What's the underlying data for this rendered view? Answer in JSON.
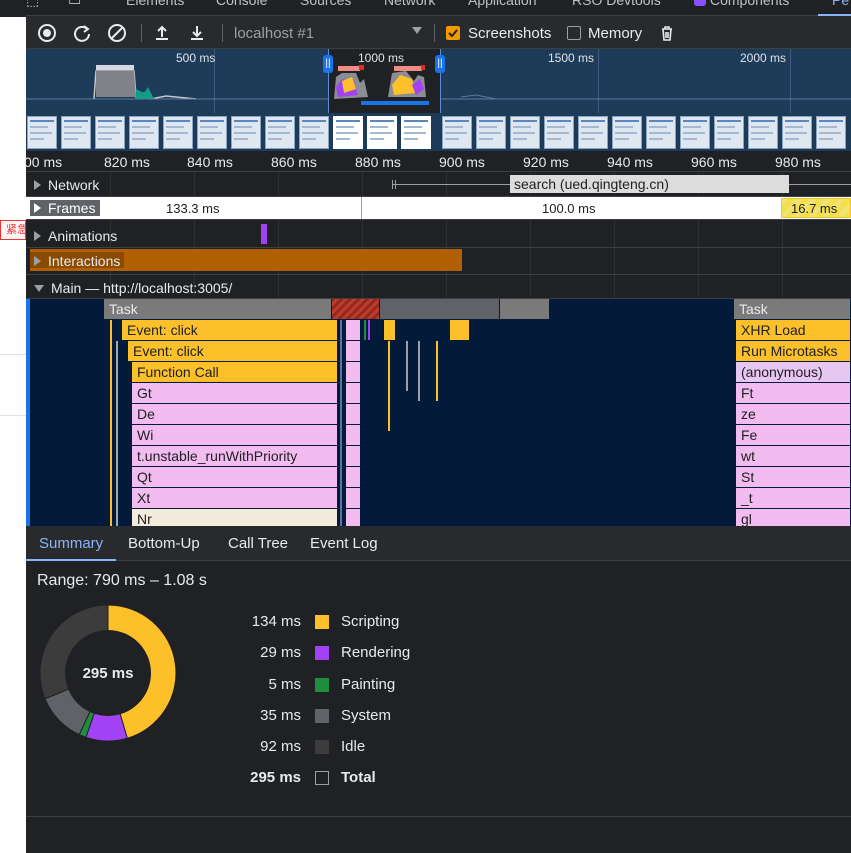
{
  "tabs": {
    "elements": "Elements",
    "console": "Console",
    "sources": "Sources",
    "network": "Network",
    "application": "Application",
    "rso": "RSO Devtools",
    "components": "Components",
    "performance_partial": "Pe"
  },
  "toolbar": {
    "profile_select": "localhost #1",
    "screenshots_label": "Screenshots",
    "screenshots_checked": true,
    "memory_label": "Memory",
    "memory_checked": false
  },
  "overview": {
    "ticks": [
      "500 ms",
      "1000 ms",
      "1500 ms",
      "2000 ms"
    ]
  },
  "ruler": {
    "labels": [
      "00 ms",
      "820 ms",
      "840 ms",
      "860 ms",
      "880 ms",
      "900 ms",
      "920 ms",
      "940 ms",
      "960 ms",
      "980 ms"
    ]
  },
  "tracks": {
    "network": "Network",
    "network_request": "search (ued.qingteng.cn)",
    "frames": "Frames",
    "frame_times": [
      "133.3 ms",
      "100.0 ms",
      "16.7 ms"
    ],
    "animations": "Animations",
    "interactions": "Interactions",
    "main": "Main — http://localhost:3005/"
  },
  "flame": {
    "left_stack": [
      "Task",
      "Event: click",
      "Event: click",
      "Function Call",
      "Gt",
      "De",
      "Wi",
      "t.unstable_runWithPriority",
      "Qt",
      "Xt",
      "Nr"
    ],
    "right_stack": [
      "Task",
      "XHR Load",
      "Run Microtasks",
      "(anonymous)",
      "Ft",
      "ze",
      "Fe",
      "wt",
      "St",
      "_t",
      "gl"
    ]
  },
  "summary_tabs": [
    "Summary",
    "Bottom-Up",
    "Call Tree",
    "Event Log"
  ],
  "summary": {
    "range": "Range: 790 ms – 1.08 s",
    "center_total": "295 ms",
    "legend": [
      {
        "value": "134 ms",
        "label": "Scripting",
        "color": "#fcc02a"
      },
      {
        "value": "29 ms",
        "label": "Rendering",
        "color": "#a142f4"
      },
      {
        "value": "5 ms",
        "label": "Painting",
        "color": "#1e8e3e"
      },
      {
        "value": "35 ms",
        "label": "System",
        "color": "#5f6368"
      },
      {
        "value": "92 ms",
        "label": "Idle",
        "color": "#3c3c3c"
      },
      {
        "value": "295 ms",
        "label": "Total",
        "color": ""
      }
    ]
  },
  "page_tag": "紧急"
}
